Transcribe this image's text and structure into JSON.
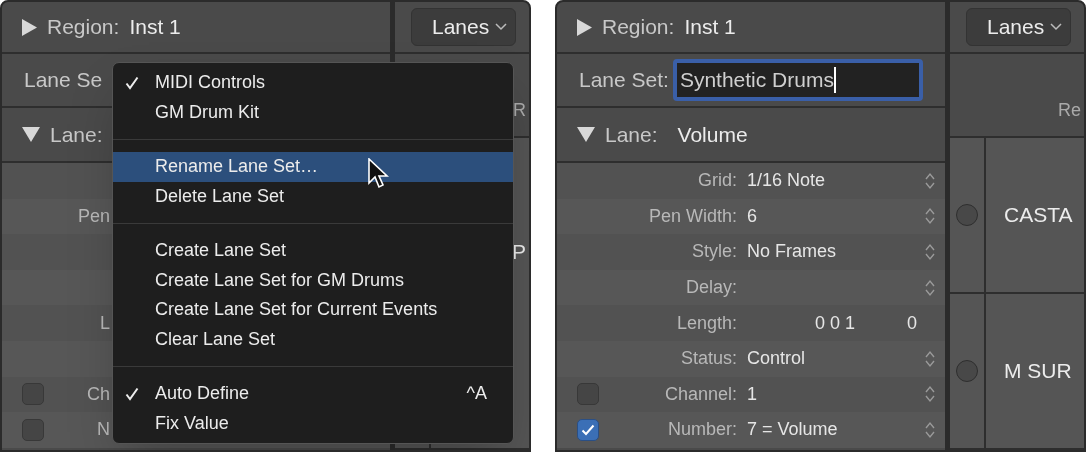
{
  "panels": [
    {
      "region_label": "Region:",
      "region_value": "Inst 1",
      "lanes_button": "Lanes",
      "lane_set_label": "Lane Se",
      "lane_label": "Lane:",
      "lanes_header": "R",
      "params": [
        {
          "kind": "plain"
        },
        {
          "kind": "plain",
          "label": "Pen"
        },
        {
          "kind": "plain"
        },
        {
          "kind": "plain"
        },
        {
          "kind": "plain",
          "label": "L"
        },
        {
          "kind": "plain"
        },
        {
          "kind": "check",
          "label": "Ch",
          "checked": false
        },
        {
          "kind": "check",
          "label": "N",
          "checked": false
        }
      ],
      "lanes": [
        {
          "name": "P",
          "dot": false
        }
      ],
      "menu": [
        {
          "kind": "item",
          "label": "MIDI Controls",
          "checked": true,
          "selected": false
        },
        {
          "kind": "item",
          "label": "GM Drum Kit",
          "checked": false,
          "selected": false
        },
        {
          "kind": "separator"
        },
        {
          "kind": "item",
          "label": "Rename Lane Set…",
          "checked": false,
          "selected": true
        },
        {
          "kind": "item",
          "label": "Delete Lane Set",
          "checked": false,
          "selected": false
        },
        {
          "kind": "separator"
        },
        {
          "kind": "item",
          "label": "Create Lane Set",
          "checked": false,
          "selected": false
        },
        {
          "kind": "item",
          "label": "Create Lane Set for GM Drums",
          "checked": false,
          "selected": false
        },
        {
          "kind": "item",
          "label": "Create Lane Set for Current Events",
          "checked": false,
          "selected": false
        },
        {
          "kind": "item",
          "label": "Clear Lane Set",
          "checked": false,
          "selected": false
        },
        {
          "kind": "separator"
        },
        {
          "kind": "item",
          "label": "Auto Define",
          "checked": true,
          "selected": false,
          "shortcut": "^A"
        },
        {
          "kind": "item",
          "label": "Fix Value",
          "checked": false,
          "selected": false
        }
      ]
    },
    {
      "region_label": "Region:",
      "region_value": "Inst 1",
      "lanes_button": "Lanes",
      "lane_set_label": "Lane Set:",
      "lane_set_value": "Synthetic Drums",
      "lane_label": "Lane:",
      "lane_value": "Volume",
      "lanes_header": "Re",
      "params": [
        {
          "kind": "plain",
          "label": "Grid:",
          "value": "1/16 Note",
          "stepper": true
        },
        {
          "kind": "plain",
          "label": "Pen Width:",
          "value": "6",
          "stepper": true
        },
        {
          "kind": "plain",
          "label": "Style:",
          "value": "No Frames",
          "stepper": true
        },
        {
          "kind": "plain",
          "label": "Delay:",
          "stepper": true
        },
        {
          "kind": "plain",
          "label": "Length:",
          "value": "0 0 1",
          "value_2": "0",
          "stepper": false
        },
        {
          "kind": "plain",
          "label": "Status:",
          "value": "Control",
          "stepper": true
        },
        {
          "kind": "check",
          "label": "Channel:",
          "value": "1",
          "checked": false,
          "stepper": true
        },
        {
          "kind": "check",
          "label": "Number:",
          "value": "7 = Volume",
          "checked": true,
          "stepper": true
        }
      ],
      "lanes": [
        {
          "name": "CASTA",
          "dot": true
        },
        {
          "name": "M SUR",
          "dot": true
        }
      ]
    }
  ]
}
